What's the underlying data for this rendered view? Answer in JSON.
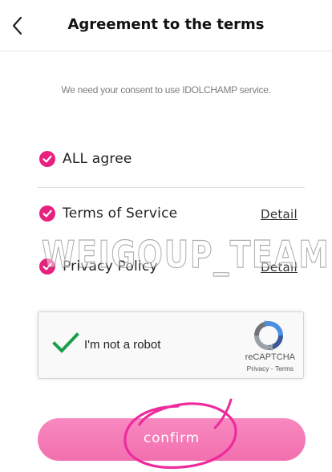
{
  "header": {
    "title": "Agreement to the terms",
    "back_icon": "chevron-left-icon"
  },
  "consent_message": "We need your consent to use IDOLCHAMP service.",
  "agreements": [
    {
      "label": "ALL agree",
      "checked": true
    },
    {
      "label": "Terms of Service",
      "checked": true,
      "detail_label": "Detail"
    },
    {
      "label": "Privacy Policy",
      "checked": true,
      "detail_label": "Detail"
    }
  ],
  "watermark": "WEIGOUP_TEAM",
  "recaptcha": {
    "label": "I'm not a robot",
    "checked": true,
    "brand": "reCAPTCHA",
    "privacy_label": "Privacy",
    "separator": " - ",
    "terms_label": "Terms"
  },
  "confirm_label": "confirm",
  "colors": {
    "accent": "#e8217e",
    "button_top": "#f889c0",
    "button_bottom": "#f16fae",
    "check_green": "#1a9e4b",
    "annotation_magenta": "#ee2a9c"
  }
}
